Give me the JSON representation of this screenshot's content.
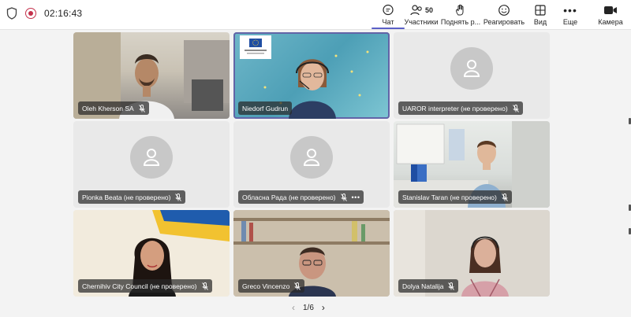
{
  "toolbar": {
    "timer": "02:16:43",
    "chat_label": "Чат",
    "participants_label": "Участники",
    "participants_count": "50",
    "raise_hand_label": "Поднять р...",
    "react_label": "Реагировать",
    "view_label": "Вид",
    "more_label": "Еще",
    "camera_label": "Камера"
  },
  "participants": [
    {
      "name": "Oleh Kherson SA",
      "video": true,
      "mic_muted": true
    },
    {
      "name": "Niedorf Gudrun",
      "video": true,
      "mic_muted": false,
      "speaking": true
    },
    {
      "name": "UAROR interpreter (не проверено)",
      "video": false,
      "mic_muted": true
    },
    {
      "name": "Pionka Beata (не проверено)",
      "video": false,
      "mic_muted": true
    },
    {
      "name": "Обласна Рада (не проверено)",
      "video": false,
      "mic_muted": true,
      "more": "•••"
    },
    {
      "name": "Stanislav Taran (не проверено)",
      "video": true,
      "mic_muted": true
    },
    {
      "name": "Chernihiv City Council (не проверено)",
      "video": true,
      "mic_muted": true
    },
    {
      "name": "Greco Vincenzo",
      "video": true,
      "mic_muted": true
    },
    {
      "name": "Dolya Natalija",
      "video": true,
      "mic_muted": true
    }
  ],
  "pager": {
    "label": "1/6"
  },
  "colors": {
    "accent": "#5b5fc7",
    "record": "#c4314b",
    "tag_bg": "#282828"
  }
}
